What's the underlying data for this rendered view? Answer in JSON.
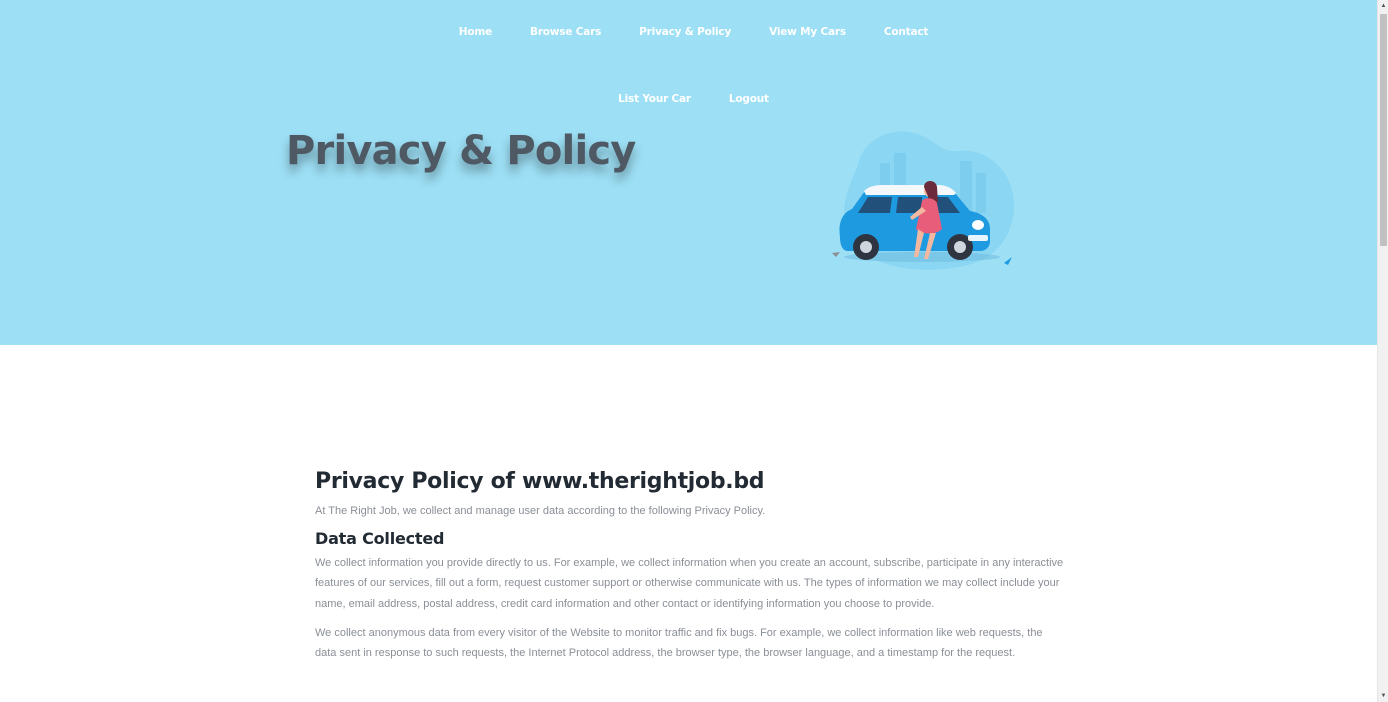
{
  "nav": {
    "row1": [
      "Home",
      "Browse Cars",
      "Privacy & Policy",
      "View My Cars",
      "Contact"
    ],
    "row2": [
      "List Your Car",
      "Logout"
    ]
  },
  "hero": {
    "title": "Privacy & Policy",
    "illustration": "woman-leaning-on-blue-car-illustration"
  },
  "content": {
    "title": "Privacy Policy of www.therightjob.bd",
    "intro": "At The Right Job, we collect and manage user data according to the following Privacy Policy.",
    "section_heading": "Data Collected",
    "paragraphs": [
      "We collect information you provide directly to us. For example, we collect information when you create an account, subscribe, participate in any interactive features of our services, fill out a form, request customer support or otherwise communicate with us. The types of information we may collect include your name, email address, postal address, credit card information and other contact or identifying information you choose to provide.",
      "We collect anonymous data from every visitor of the Website to monitor traffic and fix bugs. For example, we collect information like web requests, the data sent in response to such requests, the Internet Protocol address, the browser type, the browser language, and a timestamp for the request."
    ]
  },
  "colors": {
    "hero_bg": "#9ddff5",
    "nav_text": "#ffffff",
    "hero_title": "#4e5964",
    "heading_text": "#222a33",
    "body_text": "#8a8f96",
    "car": "#1e9be0"
  }
}
